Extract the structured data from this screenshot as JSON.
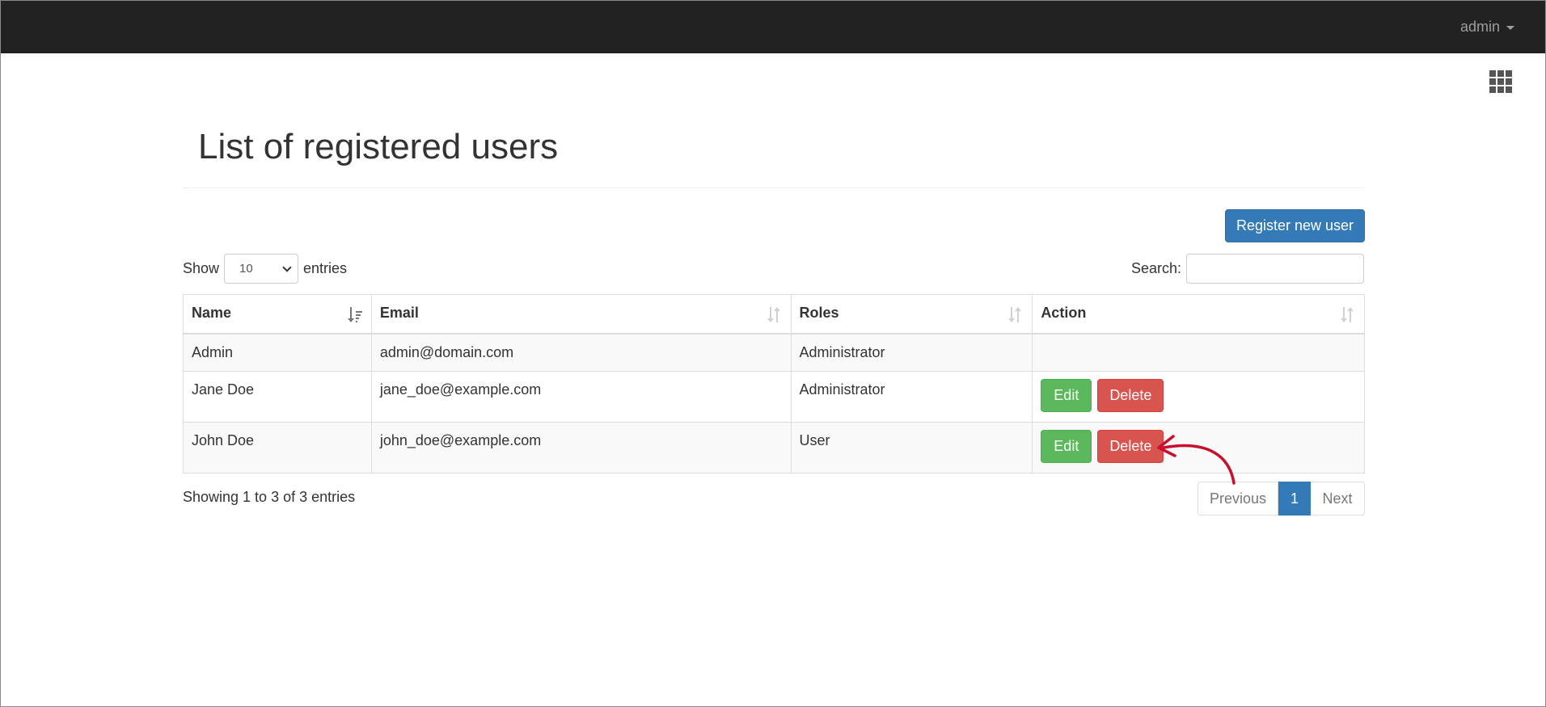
{
  "navbar": {
    "user_label": "admin"
  },
  "page": {
    "title": "List of registered users"
  },
  "toolbar": {
    "register_label": "Register new user"
  },
  "length_control": {
    "show_label": "Show",
    "selected": "10",
    "entries_label": "entries"
  },
  "search": {
    "label": "Search:",
    "value": ""
  },
  "table": {
    "headers": [
      "Name",
      "Email",
      "Roles",
      "Action"
    ],
    "rows": [
      {
        "name": "Admin",
        "email": "admin@domain.com",
        "roles": "Administrator"
      },
      {
        "name": "Jane Doe",
        "email": "jane_doe@example.com",
        "roles": "Administrator",
        "edit_label": "Edit",
        "delete_label": "Delete"
      },
      {
        "name": "John Doe",
        "email": "john_doe@example.com",
        "roles": "User",
        "edit_label": "Edit",
        "delete_label": "Delete"
      }
    ]
  },
  "footer": {
    "info": "Showing 1 to 3 of 3 entries",
    "pagination": {
      "previous": "Previous",
      "current": "1",
      "next": "Next"
    }
  },
  "colors": {
    "navbar": "#222222",
    "primary": "#337ab7",
    "success": "#5cb85c",
    "danger": "#d9534f",
    "annotation": "#c8102e"
  },
  "icons": {
    "apps": "grid-icon",
    "caret": "caret-down-icon",
    "sort": "sort-icon",
    "annotation": "curved-arrow-icon"
  }
}
